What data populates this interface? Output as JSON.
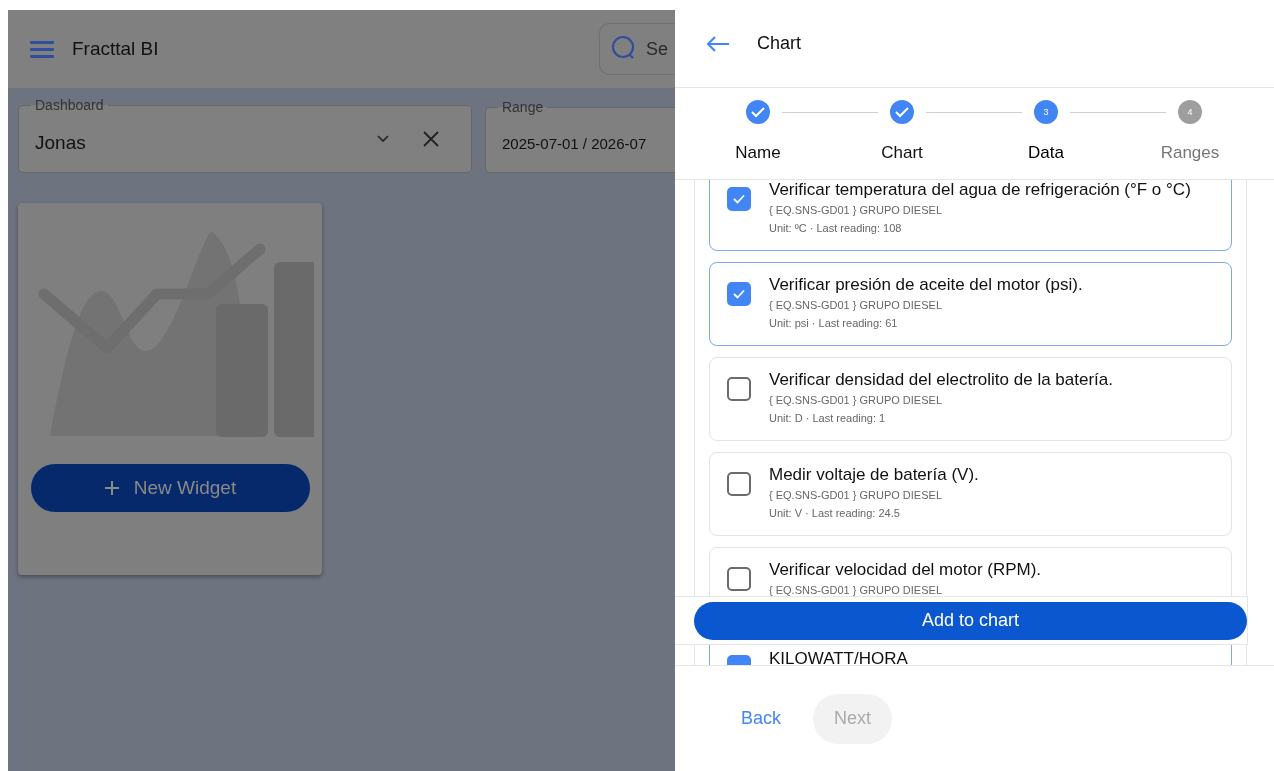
{
  "app": {
    "title": "Fracttal BI",
    "search": {
      "placeholder": "Se"
    }
  },
  "filters": [
    {
      "label": "Dashboard",
      "value": "Jonas",
      "kind": "select"
    },
    {
      "label": "Range",
      "value": "2025-07-01 / 2026-07",
      "kind": "text"
    }
  ],
  "widget_card": {
    "button": "New Widget"
  },
  "drawer": {
    "title": "Chart",
    "steps": [
      {
        "label": "Name",
        "completed": true,
        "active": false
      },
      {
        "label": "Chart",
        "completed": true,
        "active": false
      },
      {
        "label": "Data",
        "completed": false,
        "active": true,
        "number": "3"
      },
      {
        "label": "Ranges",
        "completed": false,
        "active": false,
        "number": "4"
      }
    ],
    "variables": [
      {
        "title": "Verificar temperatura del agua de refrigeración (°F o °C)",
        "equipment": "{ EQ.SNS-GD01 } GRUPO DIESEL",
        "meta": "Unit: ºC · Last reading: 108",
        "checked": true
      },
      {
        "title": "Verificar presión de aceite del motor (psi).",
        "equipment": "{ EQ.SNS-GD01 } GRUPO DIESEL",
        "meta": "Unit: psi · Last reading: 61",
        "checked": true
      },
      {
        "title": "Verificar densidad del electrolito de la batería.",
        "equipment": "{ EQ.SNS-GD01 } GRUPO DIESEL",
        "meta": "Unit: D · Last reading: 1",
        "checked": false
      },
      {
        "title": "Medir voltaje de batería (V).",
        "equipment": "{ EQ.SNS-GD01 } GRUPO DIESEL",
        "meta": "Unit: V · Last reading: 24.5",
        "checked": false
      },
      {
        "title": "Verificar velocidad del motor (RPM).",
        "equipment": "{ EQ.SNS-GD01 } GRUPO DIESEL",
        "checked": false
      }
    ],
    "add_button": "Add to chart",
    "more_variables": [
      {
        "title": "KILOWATT/HORA",
        "checked": true
      }
    ],
    "footer": {
      "back": "Back",
      "next": "Next",
      "next_disabled": true
    }
  }
}
